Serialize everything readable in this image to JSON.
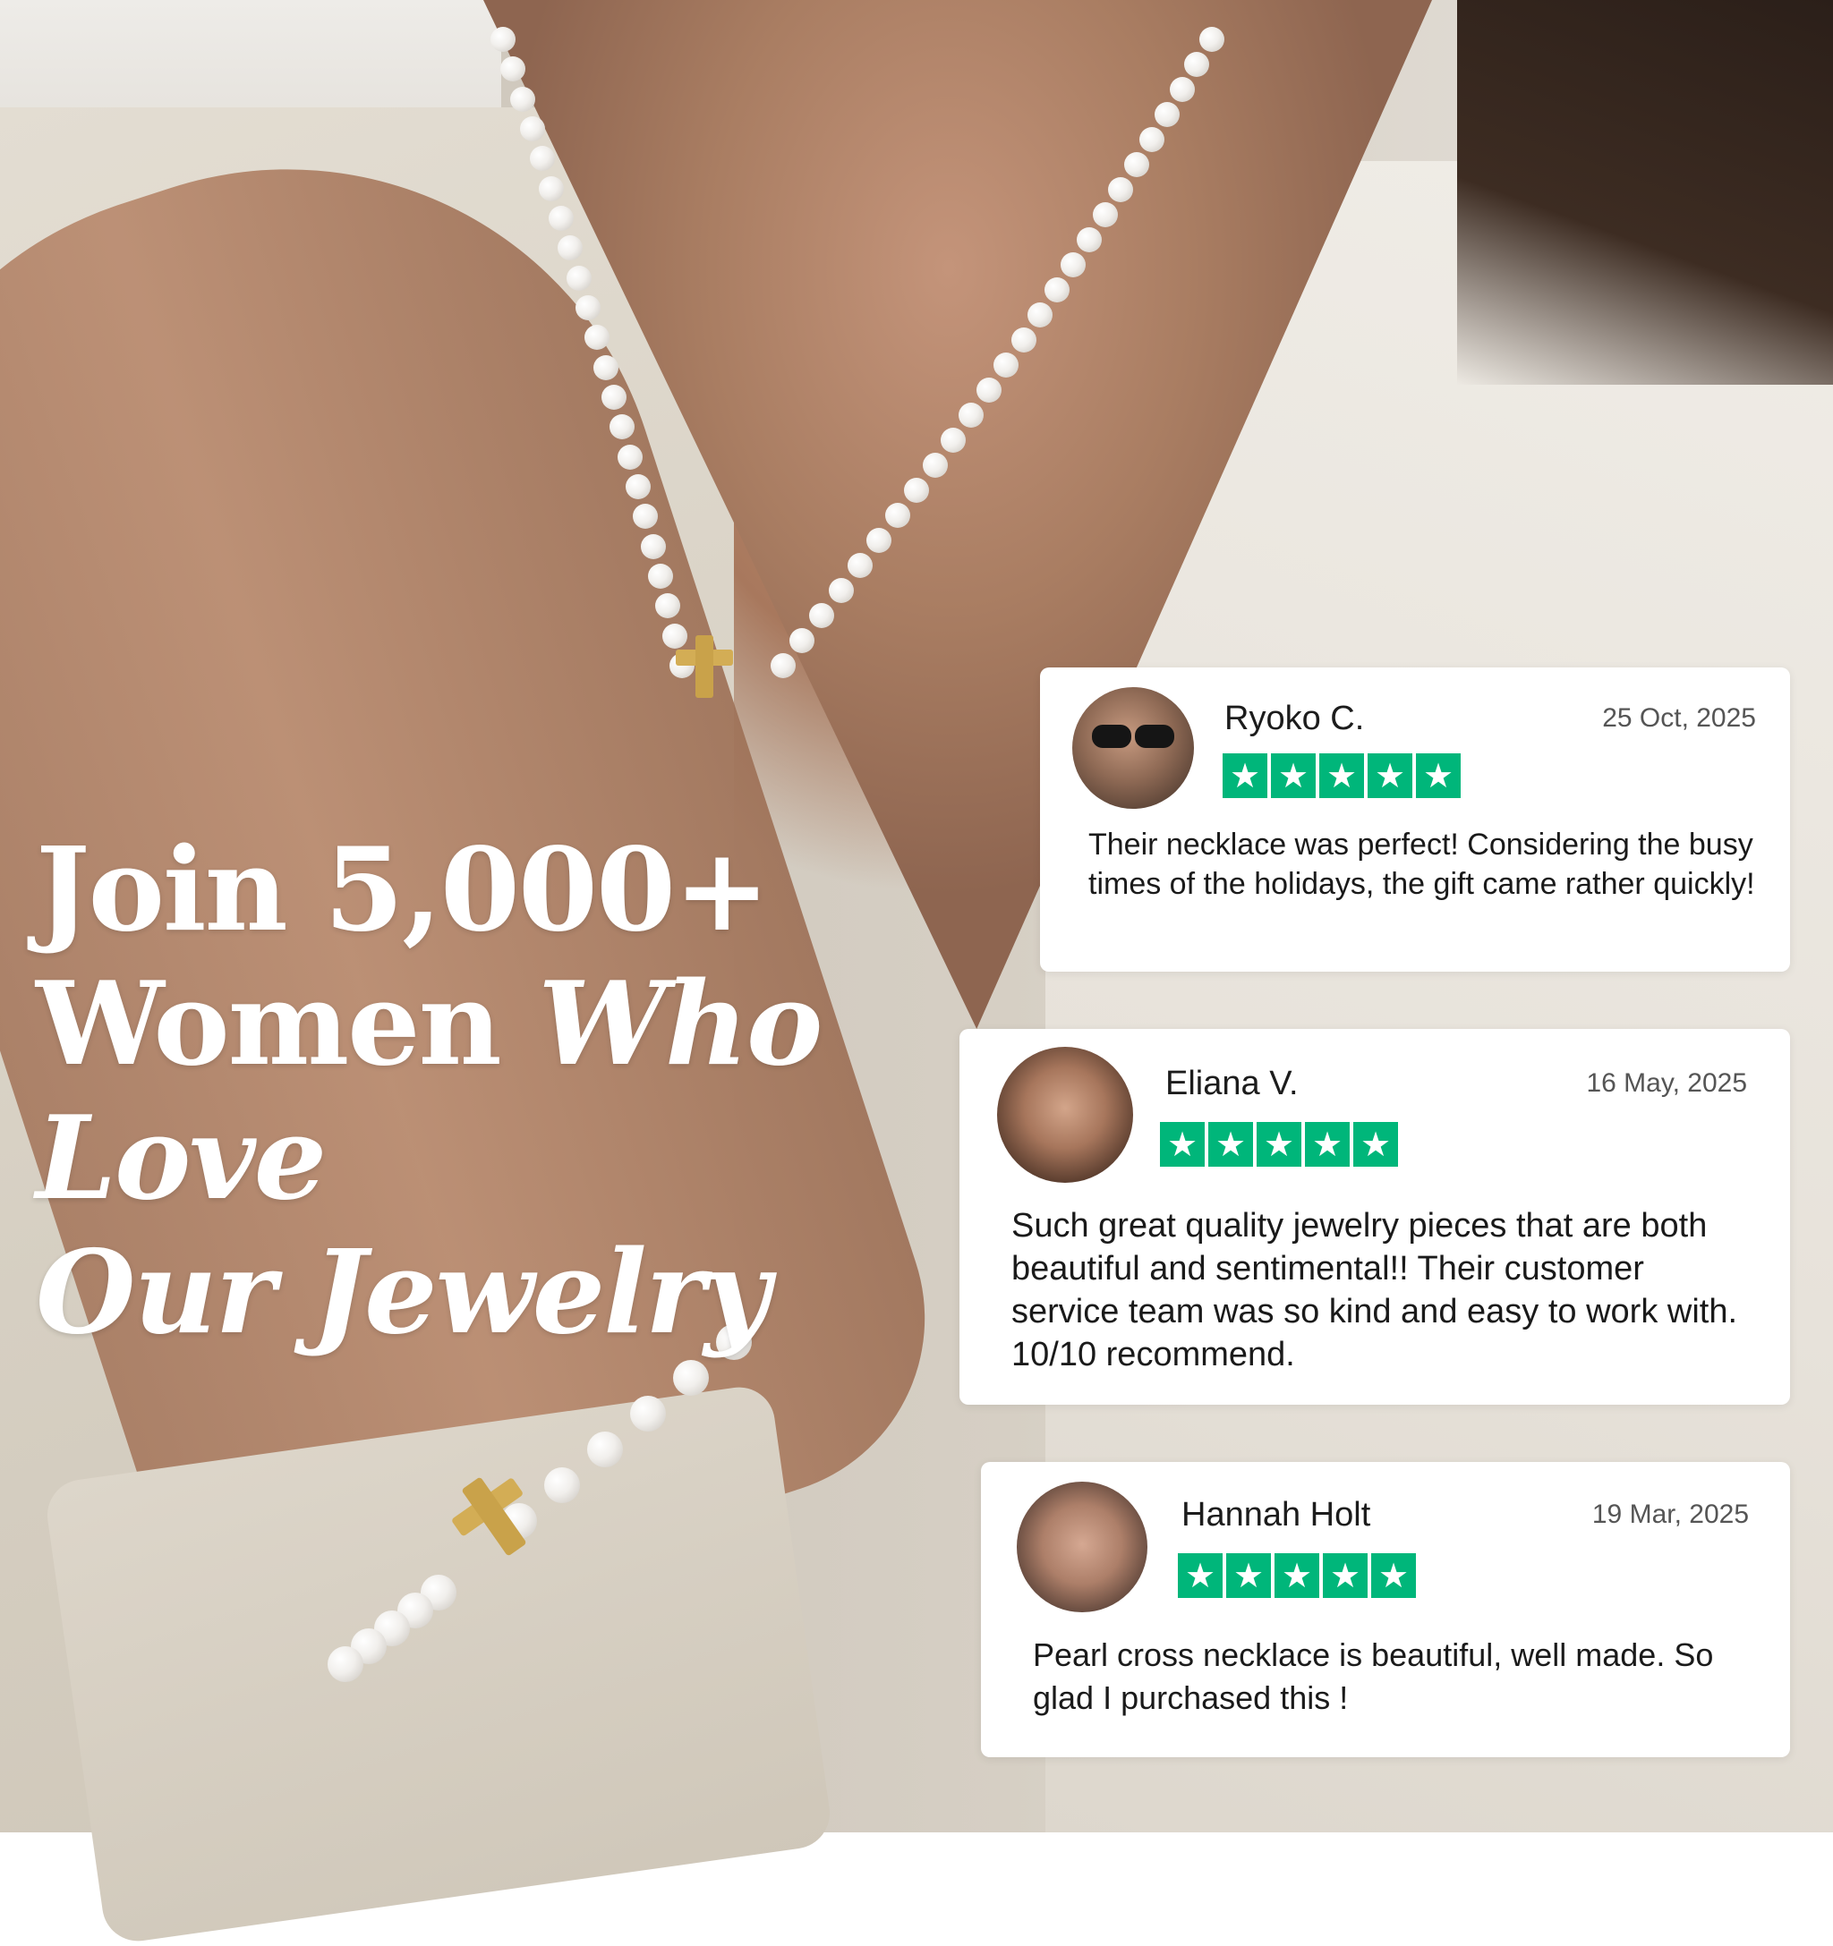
{
  "headline": {
    "line1": "Join 5,000+",
    "line2_regular": "Women ",
    "line2_italic": "Who Love",
    "line3_italic": "Our Jewelry"
  },
  "colors": {
    "star_green": "#00b67a",
    "headline": "#ffffff",
    "card_bg": "#ffffff"
  },
  "reviews": [
    {
      "name": "Ryoko C.",
      "date": "25 Oct, 2025",
      "rating": 5,
      "text": "Their necklace was perfect! Considering the busy times of the holidays, the gift came rather quickly!",
      "avatar_icon": "reviewer-photo-icon"
    },
    {
      "name": "Eliana V.",
      "date": "16 May, 2025",
      "rating": 5,
      "text": "Such great quality jewelry pieces that are both beautiful and sentimental!! Their customer service team was so kind and easy to work with. 10/10 recommend.",
      "avatar_icon": "reviewer-photo-icon"
    },
    {
      "name": "Hannah Holt",
      "date": "19 Mar, 2025",
      "rating": 5,
      "text": "Pearl cross necklace is beautiful, well made. So glad I purchased this !",
      "avatar_icon": "reviewer-photo-icon"
    }
  ]
}
